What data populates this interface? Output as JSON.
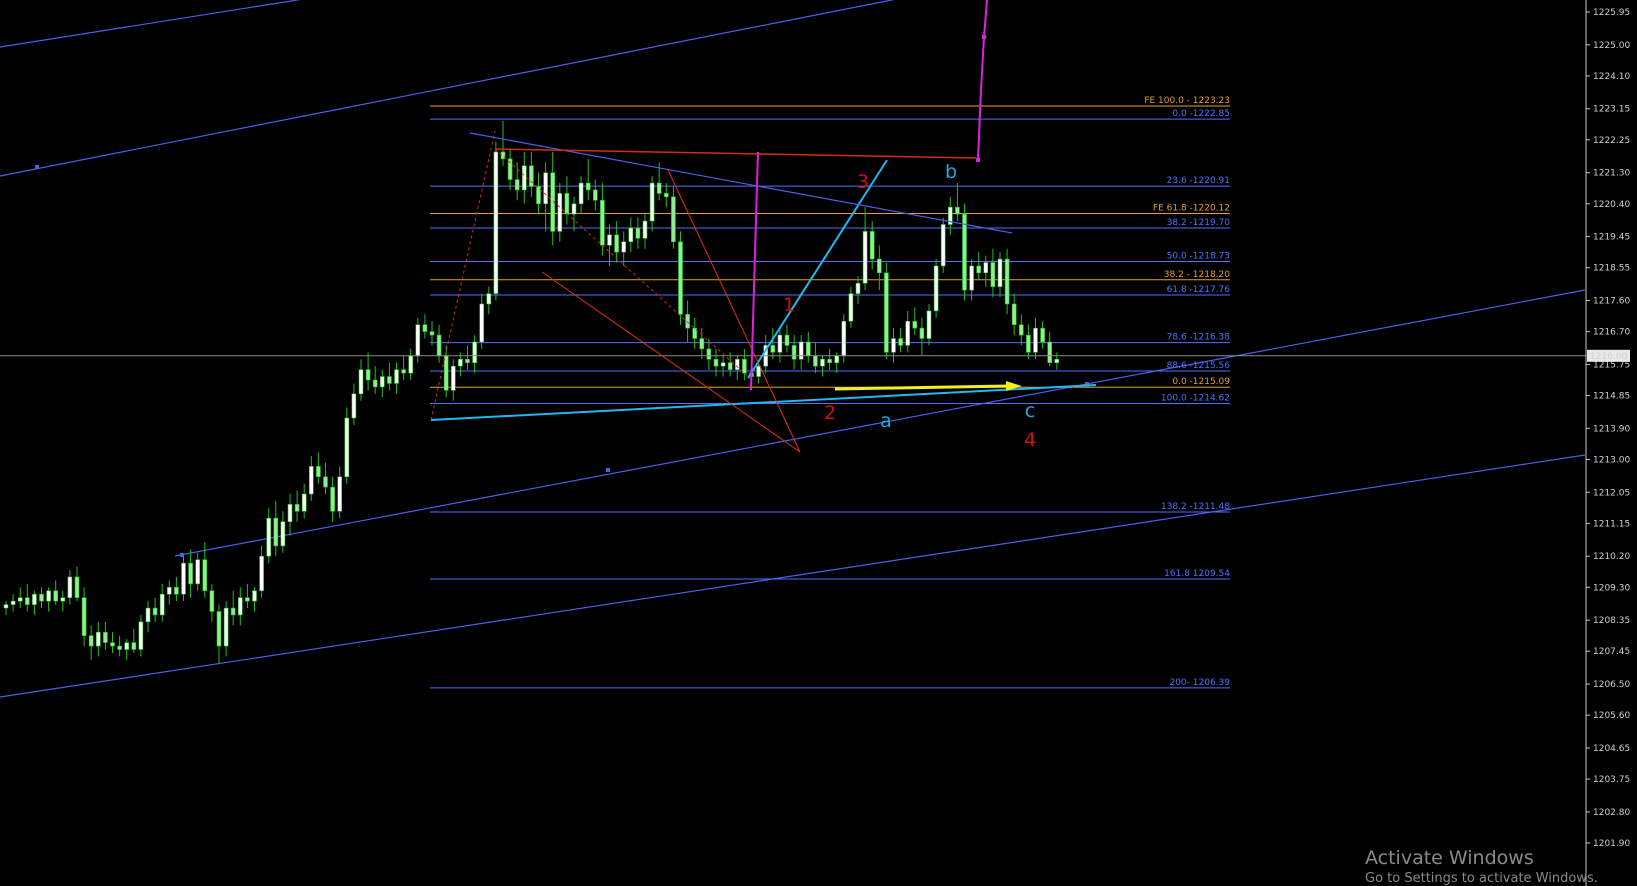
{
  "chart_data": {
    "type": "candlestick",
    "y_range": [
      1201.9,
      1226.3
    ],
    "y_ticks": [
      "1225.95",
      "1225.00",
      "1224.10",
      "1223.15",
      "1222.25",
      "1221.30",
      "1220.40",
      "1219.45",
      "1218.55",
      "1217.60",
      "1216.70",
      "1215.75",
      "1214.85",
      "1213.90",
      "1213.00",
      "1212.05",
      "1211.15",
      "1210.20",
      "1209.30",
      "1208.35",
      "1207.45",
      "1206.50",
      "1205.60",
      "1204.65",
      "1203.75",
      "1202.80",
      "1201.90"
    ],
    "current_price": "1216.00",
    "candles": [
      [
        1208.7,
        1208.9,
        1208.5,
        1208.8
      ],
      [
        1208.8,
        1209.1,
        1208.6,
        1208.9
      ],
      [
        1208.9,
        1209.3,
        1208.7,
        1209.0
      ],
      [
        1209.0,
        1209.4,
        1208.6,
        1208.8
      ],
      [
        1208.8,
        1209.2,
        1208.5,
        1209.1
      ],
      [
        1209.1,
        1209.3,
        1208.7,
        1208.9
      ],
      [
        1208.9,
        1209.3,
        1208.6,
        1209.2
      ],
      [
        1209.2,
        1209.5,
        1208.8,
        1208.9
      ],
      [
        1208.9,
        1209.2,
        1208.6,
        1209.0
      ],
      [
        1209.0,
        1209.8,
        1208.8,
        1209.6
      ],
      [
        1209.6,
        1209.9,
        1208.9,
        1209.0
      ],
      [
        1209.0,
        1209.3,
        1207.6,
        1207.9
      ],
      [
        1207.9,
        1208.2,
        1207.2,
        1207.6
      ],
      [
        1207.6,
        1208.3,
        1207.3,
        1208.0
      ],
      [
        1208.0,
        1208.3,
        1207.5,
        1207.7
      ],
      [
        1207.7,
        1208.0,
        1207.4,
        1207.6
      ],
      [
        1207.6,
        1207.9,
        1207.3,
        1207.5
      ],
      [
        1207.5,
        1207.8,
        1207.2,
        1207.7
      ],
      [
        1207.7,
        1208.1,
        1207.4,
        1207.5
      ],
      [
        1207.5,
        1208.5,
        1207.3,
        1208.3
      ],
      [
        1208.3,
        1208.9,
        1208.0,
        1208.7
      ],
      [
        1208.7,
        1209.0,
        1208.3,
        1208.5
      ],
      [
        1208.5,
        1209.4,
        1208.3,
        1209.1
      ],
      [
        1209.1,
        1209.5,
        1208.8,
        1209.3
      ],
      [
        1209.3,
        1209.6,
        1208.9,
        1209.1
      ],
      [
        1209.1,
        1210.2,
        1208.9,
        1210.0
      ],
      [
        1210.0,
        1210.4,
        1209.0,
        1209.4
      ],
      [
        1209.4,
        1210.3,
        1209.2,
        1210.1
      ],
      [
        1210.1,
        1210.6,
        1209.0,
        1209.2
      ],
      [
        1209.2,
        1209.4,
        1208.3,
        1208.6
      ],
      [
        1208.6,
        1208.8,
        1207.1,
        1207.6
      ],
      [
        1207.6,
        1208.9,
        1207.3,
        1208.7
      ],
      [
        1208.7,
        1209.2,
        1208.2,
        1208.5
      ],
      [
        1208.5,
        1209.3,
        1208.2,
        1209.0
      ],
      [
        1209.0,
        1209.4,
        1208.7,
        1208.9
      ],
      [
        1208.9,
        1209.3,
        1208.6,
        1209.2
      ],
      [
        1209.2,
        1210.5,
        1209.0,
        1210.2
      ],
      [
        1210.2,
        1211.6,
        1210.0,
        1211.3
      ],
      [
        1211.3,
        1211.8,
        1210.2,
        1210.5
      ],
      [
        1210.5,
        1211.5,
        1210.3,
        1211.2
      ],
      [
        1211.2,
        1212.0,
        1210.8,
        1211.7
      ],
      [
        1211.7,
        1212.1,
        1211.2,
        1211.5
      ],
      [
        1211.5,
        1212.3,
        1211.3,
        1212.0
      ],
      [
        1212.0,
        1213.1,
        1211.8,
        1212.8
      ],
      [
        1212.8,
        1213.2,
        1212.3,
        1212.5
      ],
      [
        1212.5,
        1212.9,
        1212.0,
        1212.2
      ],
      [
        1212.2,
        1212.5,
        1211.2,
        1211.5
      ],
      [
        1211.5,
        1212.8,
        1211.3,
        1212.5
      ],
      [
        1212.5,
        1214.5,
        1212.3,
        1214.2
      ],
      [
        1214.2,
        1215.2,
        1214.0,
        1214.9
      ],
      [
        1214.9,
        1215.9,
        1214.7,
        1215.6
      ],
      [
        1215.6,
        1216.1,
        1215.0,
        1215.3
      ],
      [
        1215.3,
        1215.7,
        1214.9,
        1215.1
      ],
      [
        1215.1,
        1215.6,
        1214.8,
        1215.4
      ],
      [
        1215.4,
        1215.8,
        1215.0,
        1215.2
      ],
      [
        1215.2,
        1215.8,
        1214.9,
        1215.6
      ],
      [
        1215.6,
        1216.0,
        1215.3,
        1215.5
      ],
      [
        1215.5,
        1216.2,
        1215.3,
        1216.0
      ],
      [
        1216.0,
        1217.1,
        1215.8,
        1216.9
      ],
      [
        1216.9,
        1217.2,
        1216.5,
        1216.7
      ],
      [
        1216.7,
        1217.0,
        1216.3,
        1216.6
      ],
      [
        1216.6,
        1216.9,
        1215.8,
        1216.0
      ],
      [
        1216.0,
        1216.3,
        1214.8,
        1215.0
      ],
      [
        1215.0,
        1215.9,
        1214.7,
        1215.7
      ],
      [
        1215.7,
        1216.1,
        1215.4,
        1215.9
      ],
      [
        1215.9,
        1216.3,
        1215.6,
        1215.8
      ],
      [
        1215.8,
        1216.6,
        1215.5,
        1216.4
      ],
      [
        1216.4,
        1217.8,
        1216.2,
        1217.5
      ],
      [
        1217.5,
        1218.0,
        1217.2,
        1217.8
      ],
      [
        1217.8,
        1222.2,
        1217.6,
        1221.9
      ],
      [
        1221.9,
        1222.8,
        1221.5,
        1221.7
      ],
      [
        1221.7,
        1222.0,
        1220.8,
        1221.1
      ],
      [
        1221.1,
        1221.6,
        1220.5,
        1220.8
      ],
      [
        1220.8,
        1221.9,
        1220.4,
        1221.5
      ],
      [
        1221.5,
        1221.9,
        1220.6,
        1220.9
      ],
      [
        1220.9,
        1221.3,
        1220.1,
        1220.4
      ],
      [
        1220.4,
        1221.6,
        1219.6,
        1221.3
      ],
      [
        1221.3,
        1221.9,
        1219.2,
        1219.6
      ],
      [
        1219.6,
        1221.0,
        1219.3,
        1220.7
      ],
      [
        1220.7,
        1221.2,
        1219.8,
        1220.1
      ],
      [
        1220.1,
        1220.6,
        1219.6,
        1220.4
      ],
      [
        1220.4,
        1221.2,
        1220.1,
        1221.0
      ],
      [
        1221.0,
        1221.7,
        1220.5,
        1220.8
      ],
      [
        1220.8,
        1221.1,
        1220.2,
        1220.5
      ],
      [
        1220.5,
        1221.0,
        1218.9,
        1219.2
      ],
      [
        1219.2,
        1219.8,
        1218.6,
        1219.5
      ],
      [
        1219.5,
        1219.9,
        1218.7,
        1219.0
      ],
      [
        1219.0,
        1219.6,
        1218.6,
        1219.3
      ],
      [
        1219.3,
        1220.0,
        1219.0,
        1219.7
      ],
      [
        1219.7,
        1220.0,
        1219.1,
        1219.4
      ],
      [
        1219.4,
        1220.1,
        1219.1,
        1219.9
      ],
      [
        1219.9,
        1221.2,
        1219.6,
        1221.0
      ],
      [
        1221.0,
        1221.6,
        1220.5,
        1220.7
      ],
      [
        1220.7,
        1221.0,
        1220.3,
        1220.6
      ],
      [
        1220.6,
        1220.9,
        1219.1,
        1219.3
      ],
      [
        1219.3,
        1219.6,
        1216.9,
        1217.2
      ],
      [
        1217.2,
        1217.6,
        1216.4,
        1216.8
      ],
      [
        1216.8,
        1217.1,
        1216.2,
        1216.5
      ],
      [
        1216.5,
        1216.8,
        1215.9,
        1216.2
      ],
      [
        1216.2,
        1216.5,
        1215.6,
        1215.9
      ],
      [
        1215.9,
        1216.2,
        1215.4,
        1215.7
      ],
      [
        1215.7,
        1216.0,
        1215.4,
        1215.8
      ],
      [
        1215.8,
        1216.1,
        1215.4,
        1215.6
      ],
      [
        1215.6,
        1216.0,
        1215.3,
        1215.9
      ],
      [
        1215.9,
        1216.2,
        1215.3,
        1215.5
      ],
      [
        1215.5,
        1215.9,
        1215.2,
        1215.4
      ],
      [
        1215.4,
        1215.8,
        1215.2,
        1215.7
      ],
      [
        1215.7,
        1216.6,
        1215.5,
        1216.3
      ],
      [
        1216.3,
        1216.8,
        1215.9,
        1216.1
      ],
      [
        1216.1,
        1216.8,
        1215.8,
        1216.6
      ],
      [
        1216.6,
        1216.9,
        1216.1,
        1216.3
      ],
      [
        1216.3,
        1216.6,
        1215.6,
        1215.9
      ],
      [
        1215.9,
        1216.6,
        1215.6,
        1216.4
      ],
      [
        1216.4,
        1216.7,
        1215.8,
        1216.0
      ],
      [
        1216.0,
        1216.4,
        1215.5,
        1215.7
      ],
      [
        1215.7,
        1216.0,
        1215.4,
        1215.9
      ],
      [
        1215.9,
        1216.2,
        1215.6,
        1215.8
      ],
      [
        1215.8,
        1216.1,
        1215.5,
        1216.0
      ],
      [
        1216.0,
        1217.2,
        1215.8,
        1217.0
      ],
      [
        1217.0,
        1218.0,
        1216.8,
        1217.8
      ],
      [
        1217.8,
        1218.3,
        1217.5,
        1218.1
      ],
      [
        1218.1,
        1220.3,
        1217.9,
        1219.6
      ],
      [
        1219.6,
        1219.9,
        1218.5,
        1218.8
      ],
      [
        1218.8,
        1219.2,
        1217.9,
        1218.4
      ],
      [
        1218.4,
        1218.7,
        1215.9,
        1216.1
      ],
      [
        1216.1,
        1216.8,
        1215.8,
        1216.5
      ],
      [
        1216.5,
        1216.8,
        1216.1,
        1216.3
      ],
      [
        1216.3,
        1217.3,
        1216.1,
        1217.0
      ],
      [
        1217.0,
        1217.4,
        1216.6,
        1216.8
      ],
      [
        1216.8,
        1217.1,
        1216.0,
        1216.5
      ],
      [
        1216.5,
        1217.5,
        1216.3,
        1217.3
      ],
      [
        1217.3,
        1218.8,
        1217.1,
        1218.6
      ],
      [
        1218.6,
        1220.0,
        1218.4,
        1219.8
      ],
      [
        1219.8,
        1220.6,
        1219.5,
        1220.3
      ],
      [
        1220.3,
        1221.0,
        1219.9,
        1220.1
      ],
      [
        1220.1,
        1220.4,
        1217.6,
        1217.9
      ],
      [
        1217.9,
        1218.8,
        1217.6,
        1218.6
      ],
      [
        1218.6,
        1219.0,
        1218.2,
        1218.4
      ],
      [
        1218.4,
        1218.9,
        1218.0,
        1218.7
      ],
      [
        1218.7,
        1219.1,
        1217.7,
        1218.0
      ],
      [
        1218.0,
        1219.0,
        1217.7,
        1218.8
      ],
      [
        1218.8,
        1219.1,
        1217.2,
        1217.5
      ],
      [
        1217.5,
        1217.8,
        1216.6,
        1216.9
      ],
      [
        1216.9,
        1217.2,
        1216.3,
        1216.6
      ],
      [
        1216.6,
        1216.9,
        1215.9,
        1216.1
      ],
      [
        1216.1,
        1217.1,
        1215.9,
        1216.8
      ],
      [
        1216.8,
        1217.0,
        1216.2,
        1216.4
      ],
      [
        1216.4,
        1216.7,
        1215.7,
        1215.8
      ],
      [
        1215.8,
        1216.1,
        1215.6,
        1215.9
      ]
    ],
    "fib_levels": [
      {
        "label": "FE 100.0 - 1223.23",
        "color": "#e0a030"
      },
      {
        "label": "0.0 -1222.85",
        "color": "#5070ff"
      },
      {
        "label": "23.6 -1220.91",
        "color": "#5070ff"
      },
      {
        "label": "FE 61.8 -1220.12",
        "color": "#e0a030"
      },
      {
        "label": "38.2 -1219.70",
        "color": "#5070ff"
      },
      {
        "label": "50.0 -1218.73",
        "color": "#5070ff"
      },
      {
        "label": "38.2 - 1218.20",
        "color": "#e0a030"
      },
      {
        "label": "61.8 -1217.76",
        "color": "#5070ff"
      },
      {
        "label": "78.6 -1216.38",
        "color": "#5070ff"
      },
      {
        "label": "88.6 -1215.56",
        "color": "#5070ff"
      },
      {
        "label": "0.0 -1215.09",
        "color": "#e0a030"
      },
      {
        "label": "100.0 -1214.62",
        "color": "#5070ff"
      },
      {
        "label": "138.2 -1211.48",
        "color": "#5070ff"
      },
      {
        "label": "161.8 1209.54",
        "color": "#5070ff"
      },
      {
        "label": "200- 1206.39",
        "color": "#5070ff"
      }
    ],
    "wave_labels": [
      {
        "text": "1",
        "color": "#d01010"
      },
      {
        "text": "2",
        "color": "#d01010"
      },
      {
        "text": "3",
        "color": "#d01010"
      },
      {
        "text": "4",
        "color": "#d01010"
      },
      {
        "text": "a",
        "color": "#20a8e0"
      },
      {
        "text": "b",
        "color": "#20a8e0"
      },
      {
        "text": "c",
        "color": "#20a8e0"
      }
    ],
    "colors": {
      "background": "#000000",
      "candle_up": "#ffffff",
      "candle_down": "#90ee90",
      "wick": "#20c020",
      "channel": "#4a60e8",
      "fib_blue": "#5070ff",
      "fib_orange": "#e0a030",
      "cyan": "#20b8f0",
      "magenta": "#e020e0",
      "red": "#e03010",
      "yellow": "#f0f020"
    }
  },
  "watermark": {
    "title": "Activate Windows",
    "subtitle": "Go to Settings to activate Windows."
  }
}
